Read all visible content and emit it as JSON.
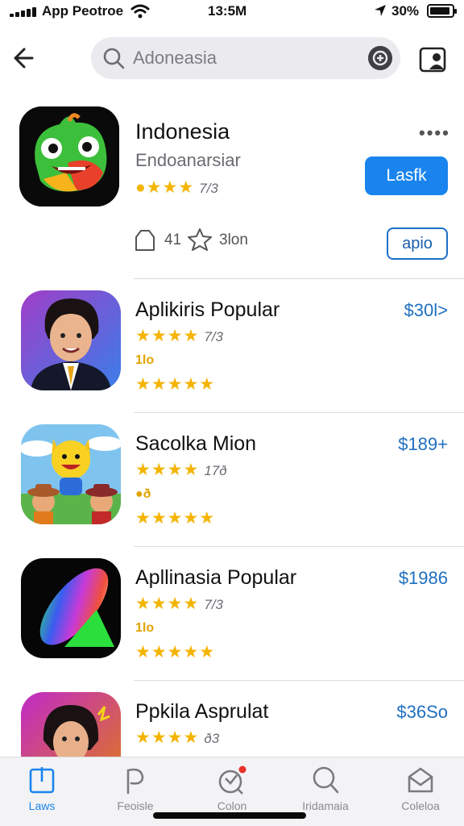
{
  "status_bar": {
    "carrier": "App Peotroe",
    "time": "13:5M",
    "battery": "30%"
  },
  "search": {
    "placeholder": "Adoneasia"
  },
  "featured": {
    "title": "Indonesia",
    "subtitle": "Endoanarsiar",
    "rating_count": "7/3",
    "get_label": "Lasfk",
    "meta_1": "41",
    "meta_2": "3lon",
    "app_label": "apio",
    "more": "••••"
  },
  "apps": [
    {
      "title": "Aplikiris Popular",
      "price": "$30l>",
      "count1": "7/3",
      "badge": "1lo",
      "stars1": "★★★★",
      "stars2_full": "★★★",
      "stars2_empty": "★★"
    },
    {
      "title": "Sacolka Mion",
      "price": "$189+",
      "count1": "17ð",
      "badge": "●ð",
      "stars1": "★★★★",
      "stars2_full": "★★★★",
      "stars2_empty": "★"
    },
    {
      "title": "Apllinasia Popular",
      "price": "$1986",
      "count1": "7/3",
      "badge": "1lo",
      "stars1": "★★★★",
      "stars2_full": "★★★★",
      "stars2_empty": "★"
    },
    {
      "title": "Ppkila Asprulat",
      "price": "$36So",
      "count1": "ð3",
      "badge": "",
      "stars1": "★★★★",
      "stars2_full": "",
      "stars2_empty": ""
    }
  ],
  "tabs": [
    {
      "label": "Laws",
      "icon": "today-icon"
    },
    {
      "label": "Feoisle",
      "icon": "games-icon"
    },
    {
      "label": "Colon",
      "icon": "apps-icon"
    },
    {
      "label": "Iridamaia",
      "icon": "search-icon"
    },
    {
      "label": "Coleloa",
      "icon": "updates-icon"
    }
  ],
  "colors": {
    "accent": "#1a84ee",
    "price": "#1f6fc0",
    "star": "#f4b400"
  }
}
